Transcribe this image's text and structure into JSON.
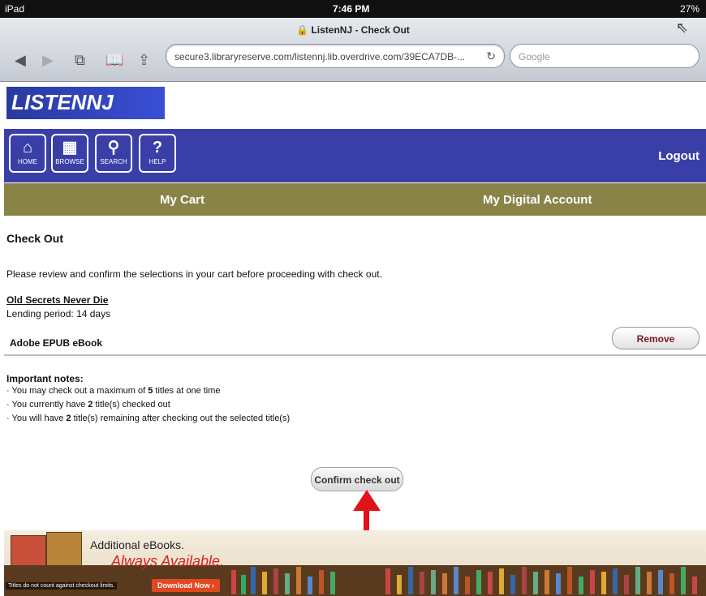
{
  "status_bar": {
    "device": "iPad",
    "time": "7:46 PM",
    "battery": "27%"
  },
  "browser": {
    "page_title": "ListenNJ - Check Out",
    "url": "secure3.libraryreserve.com/listennj.lib.overdrive.com/39ECA7DB-...",
    "search_placeholder": "Google"
  },
  "logo": {
    "text": "LISTENNJ"
  },
  "toolbar": {
    "items": [
      {
        "label": "HOME",
        "icon": "home-icon"
      },
      {
        "label": "BROWSE",
        "icon": "book-icon"
      },
      {
        "label": "SEARCH",
        "icon": "search-icon"
      },
      {
        "label": "HELP",
        "icon": "help-icon"
      }
    ],
    "logout": "Logout"
  },
  "subnav": {
    "cart": "My Cart",
    "account": "My Digital Account"
  },
  "checkout": {
    "heading": "Check Out",
    "intro": "Please review and confirm the selections in your cart before proceeding with check out.",
    "title": "Old Secrets Never Die",
    "lending": "Lending period: 14 days",
    "format": "Adobe EPUB eBook",
    "remove": "Remove"
  },
  "notes": {
    "title": "Important notes:",
    "n1_pre": "· You may check out a maximum of ",
    "n1_num": "5",
    "n1_post": " titles at one time",
    "n2_pre": "· You currently have ",
    "n2_num": "2",
    "n2_post": " title(s) checked out",
    "n3_pre": "· You will have ",
    "n3_num": "2",
    "n3_post": " title(s) remaining after checking out the selected title(s)"
  },
  "confirm": "Confirm check out",
  "banner": {
    "line1": "Additional eBooks.",
    "line2": "Always Available.",
    "download": "Download Now ›",
    "small": "Titles do not count against checkout limits."
  },
  "colors": {
    "nav_blue": "#3a3fa8",
    "subnav_olive": "#8a8348",
    "arrow_red": "#e0121a"
  }
}
